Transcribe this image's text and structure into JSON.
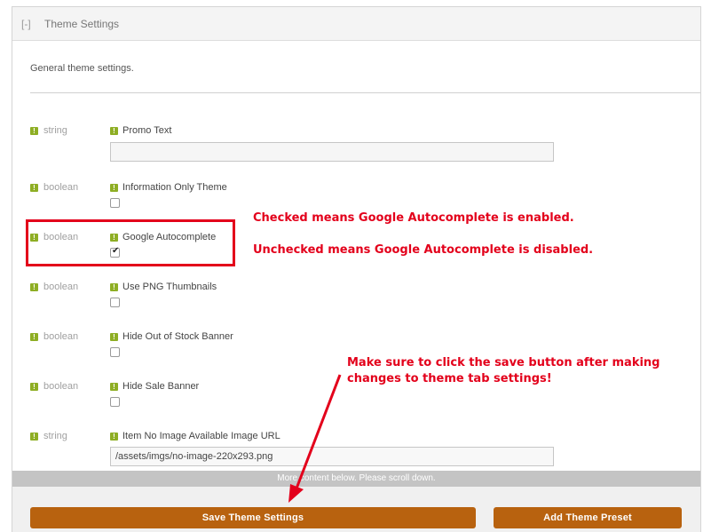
{
  "header": {
    "collapse_label": "[-]",
    "title": "Theme Settings"
  },
  "description": "General theme settings.",
  "settings": [
    {
      "type": "string",
      "name": "Promo Text",
      "value": ""
    },
    {
      "type": "boolean",
      "name": "Information Only Theme",
      "checked": false
    },
    {
      "type": "boolean",
      "name": "Google Autocomplete",
      "checked": true
    },
    {
      "type": "boolean",
      "name": "Use PNG Thumbnails",
      "checked": false
    },
    {
      "type": "boolean",
      "name": "Hide Out of Stock Banner",
      "checked": false
    },
    {
      "type": "boolean",
      "name": "Hide Sale Banner",
      "checked": false
    },
    {
      "type": "string",
      "name": "Item No Image Available Image URL",
      "value": "/assets/imgs/no-image-220x293.png"
    }
  ],
  "scroll_hint": "More content below. Please scroll down.",
  "buttons": {
    "save": "Save Theme Settings",
    "add_preset": "Add Theme Preset"
  },
  "annotations": {
    "checked_note": "Checked means Google Autocomplete is enabled.",
    "unchecked_note": "Unchecked means Google Autocomplete is disabled.",
    "save_note_line1": "Make sure to click the save button after making",
    "save_note_line2": "changes to theme tab settings!"
  },
  "icons": {
    "info": "info-icon",
    "check": "checkmark-icon"
  },
  "colors": {
    "accent_button": "#b8620f",
    "info_icon": "#8eae24",
    "annotation": "#e3001b"
  }
}
